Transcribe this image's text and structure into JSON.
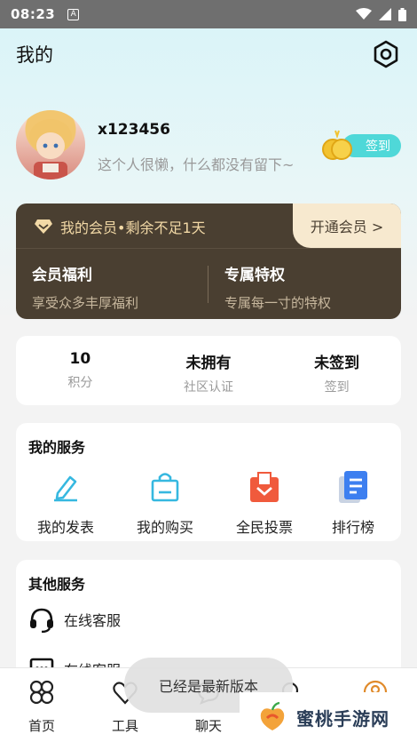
{
  "status": {
    "time": "08:23",
    "notif_letter": "A"
  },
  "header": {
    "title": "我的"
  },
  "profile": {
    "username": "x123456",
    "bio": "这个人很懒，什么都没有留下~",
    "checkin_label": "签到"
  },
  "vip": {
    "status_text": "我的会员•剩余不足1天",
    "open_label": "开通会员 >",
    "benefit_title": "会员福利",
    "benefit_desc": "享受众多丰厚福利",
    "privilege_title": "专属特权",
    "privilege_desc": "专属每一寸的特权"
  },
  "stats": [
    {
      "value": "10",
      "label": "积分"
    },
    {
      "value": "未拥有",
      "label": "社区认证"
    },
    {
      "value": "未签到",
      "label": "签到"
    }
  ],
  "my_services": {
    "title": "我的服务",
    "items": [
      {
        "label": "我的发表",
        "icon": "edit-icon"
      },
      {
        "label": "我的购买",
        "icon": "shopping-bag-icon"
      },
      {
        "label": "全民投票",
        "icon": "vote-box-icon"
      },
      {
        "label": "排行榜",
        "icon": "ranking-doc-icon"
      }
    ]
  },
  "other_services": {
    "title": "其他服务",
    "items": [
      {
        "label": "在线客服",
        "icon": "headset-icon"
      },
      {
        "label": "在线客服",
        "icon": "message-icon"
      }
    ]
  },
  "toast": "已经是最新版本",
  "tabs": [
    {
      "label": "首页",
      "icon": "home-icon"
    },
    {
      "label": "工具",
      "icon": "tools-icon"
    },
    {
      "label": "聊天",
      "icon": "chat-icon"
    },
    {
      "label": "",
      "icon": "community-icon"
    },
    {
      "label": "",
      "icon": "profile-icon"
    }
  ],
  "watermark": {
    "text": "蜜桃手游网"
  },
  "colors": {
    "accent": "#4fd8d8",
    "vip_bg": "#4a3f31",
    "vip_gold": "#f2d9a6",
    "vote_red": "#f05a3c",
    "rank_blue": "#3d7ff0"
  }
}
